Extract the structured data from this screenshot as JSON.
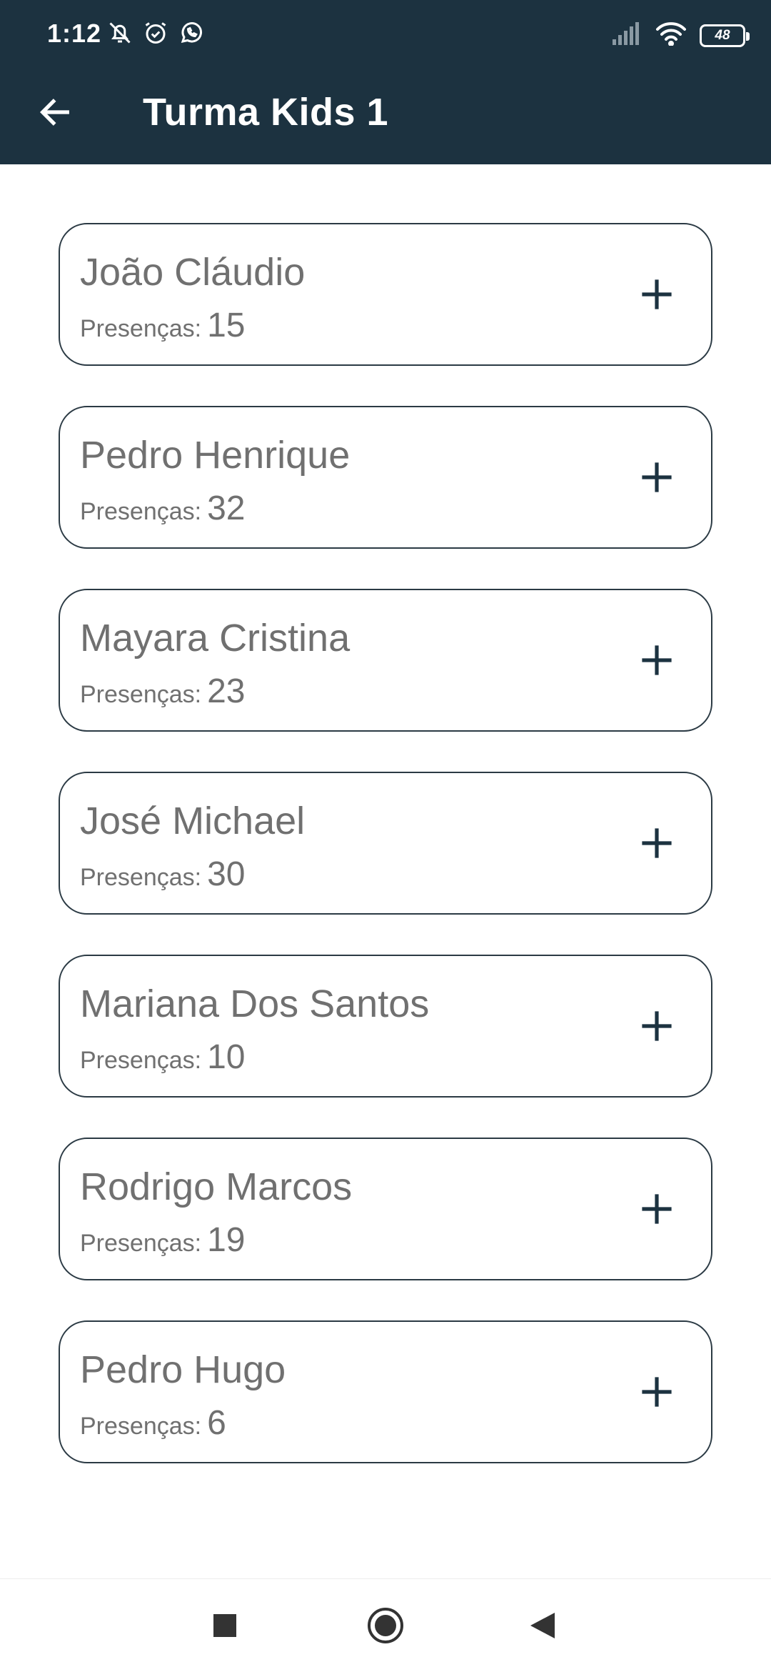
{
  "status_bar": {
    "time": "1:12",
    "battery": "48",
    "icons_left": [
      "bell-off-icon",
      "alarm-icon",
      "whatsapp-icon"
    ],
    "icons_right": [
      "signal-icon",
      "wifi-icon",
      "battery-icon"
    ]
  },
  "app_bar": {
    "title": "Turma Kids 1",
    "back_icon": "arrow-left-icon"
  },
  "students": [
    {
      "name": "João Cláudio",
      "label": "Presenças:",
      "count": "15"
    },
    {
      "name": "Pedro Henrique",
      "label": "Presenças:",
      "count": "32"
    },
    {
      "name": "Mayara Cristina",
      "label": "Presenças:",
      "count": "23"
    },
    {
      "name": "José Michael",
      "label": "Presenças:",
      "count": "30"
    },
    {
      "name": "Mariana Dos Santos",
      "label": "Presenças:",
      "count": "10"
    },
    {
      "name": "Rodrigo Marcos",
      "label": "Presenças:",
      "count": "19"
    },
    {
      "name": "Pedro Hugo",
      "label": "Presenças:",
      "count": "6"
    }
  ],
  "nav_bar": {
    "buttons": [
      "recents-square-icon",
      "home-circle-icon",
      "back-triangle-icon"
    ]
  },
  "colors": {
    "app_bar": "#1c3240",
    "text_muted": "#707070",
    "card_border": "#2b3a44",
    "plus": "#1c3240"
  }
}
